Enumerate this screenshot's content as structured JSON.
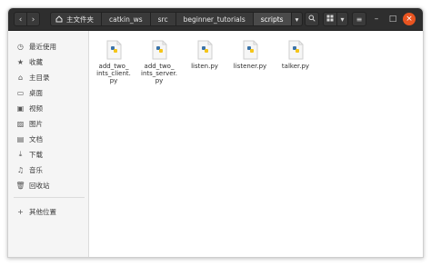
{
  "breadcrumbs": [
    "主文件夹",
    "catkin_ws",
    "src",
    "beginner_tutorials",
    "scripts"
  ],
  "sidebar": {
    "items": [
      {
        "label": "最近使用",
        "icon": "clock-icon"
      },
      {
        "label": "收藏",
        "icon": "star-icon"
      },
      {
        "label": "主目录",
        "icon": "home-icon"
      },
      {
        "label": "桌面",
        "icon": "desktop-icon"
      },
      {
        "label": "视频",
        "icon": "video-icon"
      },
      {
        "label": "图片",
        "icon": "picture-icon"
      },
      {
        "label": "文档",
        "icon": "document-icon"
      },
      {
        "label": "下载",
        "icon": "download-icon"
      },
      {
        "label": "音乐",
        "icon": "music-icon"
      },
      {
        "label": "回收站",
        "icon": "trash-icon"
      }
    ],
    "other": {
      "label": "其他位置",
      "icon": "plus-icon"
    }
  },
  "files": [
    {
      "name": "add_two_\nints_client.\npy"
    },
    {
      "name": "add_two_\nints_server.\npy"
    },
    {
      "name": "listen.py"
    },
    {
      "name": "listener.py"
    },
    {
      "name": "talker.py"
    }
  ],
  "colors": {
    "headerbar": "#2e2e2e",
    "close": "#e95420",
    "python_blue": "#3b73a8",
    "python_yellow": "#f5c518"
  }
}
